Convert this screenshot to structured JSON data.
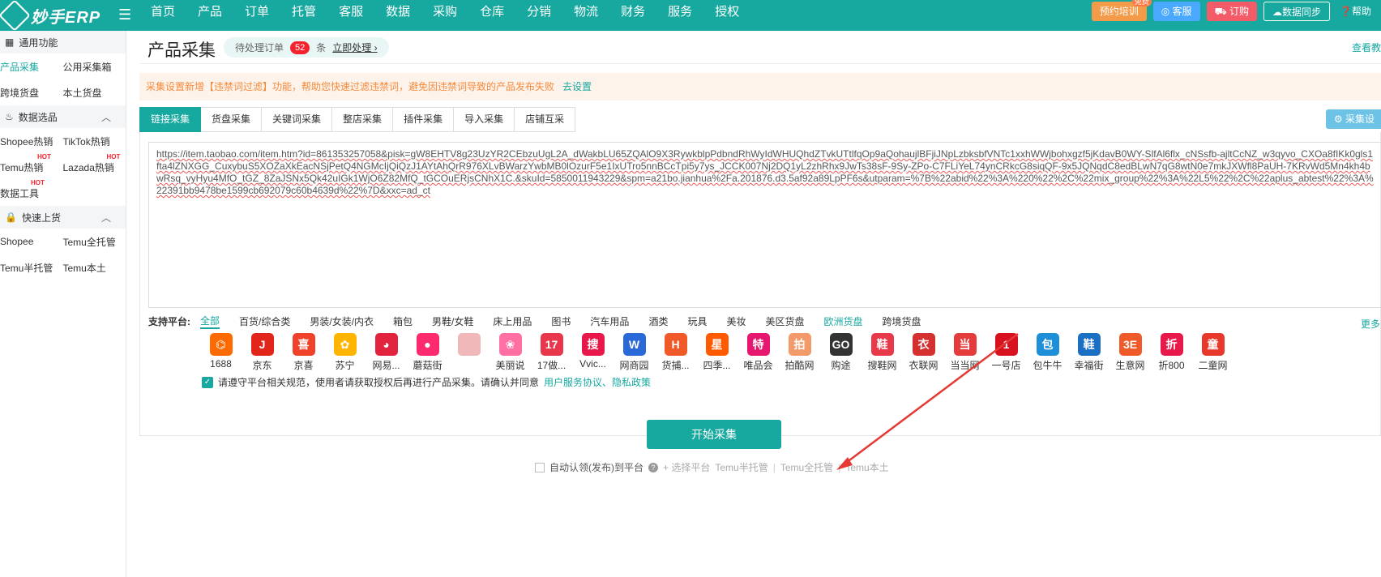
{
  "app": {
    "logo_text": "妙手ERP"
  },
  "nav": [
    "首页",
    "产品",
    "订单",
    "托管",
    "客服",
    "数据",
    "采购",
    "仓库",
    "分销",
    "物流",
    "财务",
    "服务",
    "授权"
  ],
  "topright": {
    "training": "预约培训",
    "free": "免费",
    "service": "客服",
    "order": "订购",
    "sync": "数据同步",
    "help": "帮助"
  },
  "sidebar": {
    "common": {
      "title": "通用功能",
      "items": [
        [
          "产品采集",
          "公用采集箱"
        ],
        [
          "跨境货盘",
          "本土货盘"
        ]
      ]
    },
    "data": {
      "title": "数据选品",
      "items": [
        [
          "Shopee热销",
          "TikTok热销"
        ],
        [
          "Temu热销",
          "Lazada热销"
        ],
        [
          "数据工具",
          ""
        ]
      ],
      "hot": "HOT"
    },
    "quick": {
      "title": "快速上货",
      "items": [
        [
          "Shopee",
          "Temu全托管"
        ],
        [
          "Temu半托管",
          "Temu本土"
        ]
      ]
    }
  },
  "page": {
    "title": "产品采集",
    "pending": {
      "label": "待处理订单",
      "count": "52",
      "unit": "条",
      "action": "立即处理 ›"
    },
    "view_link": "查看教",
    "notice": "采集设置新增【违禁词过滤】功能，帮助您快速过滤违禁词，避免因违禁词导致的产品发布失败",
    "notice_link": "去设置",
    "tabs": [
      "链接采集",
      "货盘采集",
      "关键词采集",
      "整店采集",
      "插件采集",
      "导入采集",
      "店铺互采"
    ],
    "settings_btn": "采集设",
    "url_text": "https://item.taobao.com/item.htm?id=861353257058&pisk=gW8EHTV8g23UzYR2CEbzuUgL2A_dWakbLU65ZQAlO9X3RywkblpPdbndRhWyIdWHUQhdZTvkUTtlfqOp9aQohaujlBFjiJNpLzbksbfVNTc1xxhWWjbohxgzf5jKdavB0WY-SlfAl6flx_cNSsfb-ajltCcNZ_w3qyvo_CXOa8fIKk0gls1fta4lZNXGG_CuxybuS5XOZaXkEacNSjPetQ4NGMcIjQiQzJ1AYtAhQrR976XLvBWarzYwbMB0lOzurF5e1IxUTro5nnBCcTpi5y7ys_JCCK007Nj2DQ1yL2zhRhx9JwTs38sF-9Sy-ZPo-C7FLiYeL74ynCRkcG8siqQF-9x5JQNqdC8edBLwN7qG8wtN0e7mkJXWfl8PaUH-7KRvWd5Mn4kh4bwRsq_vyHyu4MfO_tGZ_8ZaJSNx5Qk42uIGk1WjO6Z82MfQ_tGCOuERjsCNhX1C.&skuId=5850011943229&spm=a21bo.jianhua%2Fa.201876.d3.5af92a89LpPF6s&utparam=%7B%22abid%22%3A%220%22%2C%22mix_group%22%3A%22L5%22%2C%22aplus_abtest%22%3A%22391bb9478be1599cb692079c60b4639d%22%7D&xxc=ad_ct",
    "platform_label": "支持平台:",
    "categories": [
      "全部",
      "百货/综合类",
      "男装/女装/内衣",
      "箱包",
      "男鞋/女鞋",
      "床上用品",
      "图书",
      "汽车用品",
      "酒类",
      "玩具",
      "美妆",
      "美区货盘",
      "欧洲货盘",
      "跨境货盘"
    ],
    "more": "更多",
    "platforms": [
      {
        "name": "1688",
        "glyph": "⌬",
        "color": "#ff6a00"
      },
      {
        "name": "京东",
        "glyph": "J",
        "color": "#e1251b"
      },
      {
        "name": "京喜",
        "glyph": "喜",
        "color": "#f0412b"
      },
      {
        "name": "苏宁",
        "glyph": "✿",
        "color": "#ffb400"
      },
      {
        "name": "网易...",
        "glyph": "◕",
        "color": "#e2233e"
      },
      {
        "name": "蘑菇街",
        "glyph": "●",
        "color": "#ff2a6d"
      },
      {
        "name": "",
        "glyph": "",
        "color": "#f0b8b8"
      },
      {
        "name": "美丽说",
        "glyph": "❀",
        "color": "#ff6fa3"
      },
      {
        "name": "17做...",
        "glyph": "17",
        "color": "#e8374a"
      },
      {
        "name": "Vvic...",
        "glyph": "搜",
        "color": "#e8194a"
      },
      {
        "name": "网商园",
        "glyph": "W",
        "color": "#2a6ad8"
      },
      {
        "name": "货捕...",
        "glyph": "H",
        "color": "#f05a28"
      },
      {
        "name": "四季...",
        "glyph": "星",
        "color": "#ff5a00"
      },
      {
        "name": "唯品会",
        "glyph": "特",
        "color": "#e6176f"
      },
      {
        "name": "拍酷网",
        "glyph": "拍",
        "color": "#f39a6a"
      },
      {
        "name": "购途",
        "glyph": "GO",
        "color": "#333333"
      },
      {
        "name": "搜鞋网",
        "glyph": "鞋",
        "color": "#e8394a"
      },
      {
        "name": "衣联网",
        "glyph": "衣",
        "color": "#d43030"
      },
      {
        "name": "当当网",
        "glyph": "当",
        "color": "#e43c3c"
      },
      {
        "name": "一号店",
        "glyph": "1",
        "color": "#d8111f"
      },
      {
        "name": "包牛牛",
        "glyph": "包",
        "color": "#1c8fd8"
      },
      {
        "name": "幸福街",
        "glyph": "鞋",
        "color": "#1a6fc2"
      },
      {
        "name": "生意网",
        "glyph": "3E",
        "color": "#f05a28"
      },
      {
        "name": "折800",
        "glyph": "折",
        "color": "#e8194a"
      },
      {
        "name": "二童网",
        "glyph": "童",
        "color": "#e8382c"
      }
    ],
    "agreement": "请遵守平台相关规范，使用者请获取授权后再进行产品采集。请确认并同意",
    "agreement_link": "用户服务协议、隐私政策",
    "start_btn": "开始采集",
    "auto": {
      "label": "自动认领(发布)到平台",
      "select": "+ 选择平台",
      "opts": [
        "Temu半托管",
        "Temu全托管",
        "Temu本土"
      ]
    }
  }
}
